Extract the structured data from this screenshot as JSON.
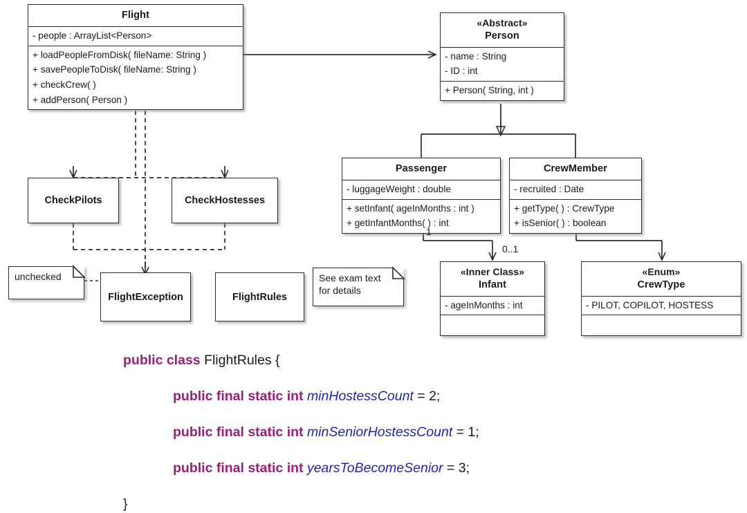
{
  "diagram": {
    "title": "Flight UML class diagram",
    "classes": {
      "flight": {
        "name": "Flight",
        "attributes": [
          "- people : ArrayList<Person>"
        ],
        "methods": [
          "+ loadPeopleFromDisk( fileName: String )",
          "+ savePeopleToDisk( fileName: String )",
          "+ checkCrew( )",
          "+ addPerson( Person )"
        ]
      },
      "person": {
        "stereotype": "«Abstract»",
        "name": "Person",
        "attributes": [
          "- name : String",
          "- ID : int"
        ],
        "methods": [
          "+ Person( String, int )"
        ]
      },
      "passenger": {
        "name": "Passenger",
        "attributes": [
          "- luggageWeight : double"
        ],
        "methods": [
          "+ setInfant( ageInMonths : int )",
          "+ getInfantMonths( ) : int"
        ]
      },
      "crewmember": {
        "name": "CrewMember",
        "attributes": [
          "- recruited : Date"
        ],
        "methods": [
          "+ getType( ) : CrewType",
          "+ isSenior( ) : boolean"
        ]
      },
      "infant": {
        "stereotype": "«Inner Class»",
        "name": "Infant",
        "attributes": [
          "- ageInMonths : int"
        ],
        "methods": []
      },
      "crewtype": {
        "stereotype": "«Enum»",
        "name": "CrewType",
        "attributes": [
          "- PILOT, COPILOT, HOSTESS"
        ],
        "methods": []
      },
      "checkpilots": {
        "name": "CheckPilots"
      },
      "checkhostesses": {
        "name": "CheckHostesses"
      },
      "flightexception": {
        "name": "FlightException"
      },
      "flightrules": {
        "name": "FlightRules"
      }
    },
    "notes": {
      "unchecked": "unchecked",
      "exam_text": "See exam text\nfor details"
    },
    "multiplicities": {
      "passenger_infant_source": "1",
      "passenger_infant_target": "0..1"
    }
  },
  "code": {
    "lines": [
      [
        {
          "t": "public class ",
          "s": "kw"
        },
        {
          "t": "FlightRules {",
          "s": "pl"
        }
      ],
      [
        {
          "t": "INDENT",
          "s": "indent"
        },
        {
          "t": "public final static int ",
          "s": "kw"
        },
        {
          "t": "minHostessCount",
          "s": "id"
        },
        {
          "t": " = 2;",
          "s": "pl"
        }
      ],
      [
        {
          "t": "INDENT",
          "s": "indent"
        },
        {
          "t": "public final static int ",
          "s": "kw"
        },
        {
          "t": "minSeniorHostessCount",
          "s": "id"
        },
        {
          "t": " = 1;",
          "s": "pl"
        }
      ],
      [
        {
          "t": "INDENT",
          "s": "indent"
        },
        {
          "t": "public final static int ",
          "s": "kw"
        },
        {
          "t": "yearsToBecomeSenior",
          "s": "id"
        },
        {
          "t": " = 3;",
          "s": "pl"
        }
      ],
      [
        {
          "t": "}",
          "s": "pl"
        }
      ]
    ],
    "colors": {
      "keyword": "#9c1e78",
      "identifier": "#2323b4",
      "plain": "#1a1a1a"
    }
  }
}
